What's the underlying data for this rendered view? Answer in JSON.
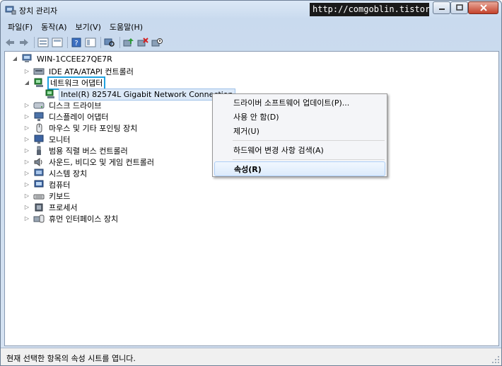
{
  "window": {
    "title": "장치 관리자"
  },
  "watermark": "http://comgoblin.tistory.com",
  "menu": [
    "파일(F)",
    "동작(A)",
    "보기(V)",
    "도움말(H)"
  ],
  "toolbar": {
    "icons": [
      "back-icon",
      "forward-icon",
      "properties-icon",
      "view-icon",
      "help-icon",
      "view2-icon",
      "scan-icon",
      "update-driver-icon",
      "uninstall-icon",
      "disable-icon"
    ]
  },
  "tree": {
    "root": "WIN-1CCEE27QE7R",
    "items": [
      {
        "label": "IDE ATA/ATAPI 컨트롤러"
      },
      {
        "label": "네트워크 어댑터"
      },
      {
        "label": "Intel(R) 82574L Gigabit Network Connection"
      },
      {
        "label": "디스크 드라이브"
      },
      {
        "label": "디스플레이 어댑터"
      },
      {
        "label": "마우스 및 기타 포인팅 장치"
      },
      {
        "label": "모니터"
      },
      {
        "label": "범용 직렬 버스 컨트롤러"
      },
      {
        "label": "사운드, 비디오 및 게임 컨트롤러"
      },
      {
        "label": "시스템 장치"
      },
      {
        "label": "컴퓨터"
      },
      {
        "label": "키보드"
      },
      {
        "label": "프로세서"
      },
      {
        "label": "휴먼 인터페이스 장치"
      }
    ]
  },
  "context_menu": {
    "update": "드라이버 소프트웨어 업데이트(P)...",
    "disable": "사용 안 함(D)",
    "uninstall": "제거(U)",
    "scan": "하드웨어 변경 사항 검색(A)",
    "properties": "속성(R)"
  },
  "status": "현재 선택한 항목의 속성 시트를 엽니다."
}
